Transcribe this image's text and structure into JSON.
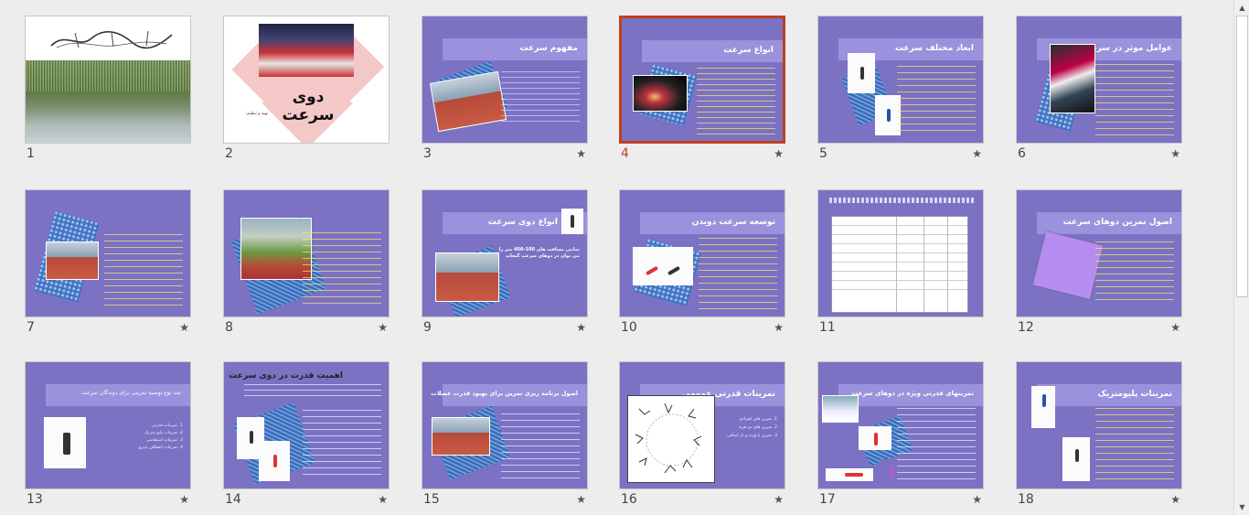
{
  "sorter": {
    "selected_index": 4,
    "slides": [
      {
        "number": "1",
        "title": "",
        "starred": false
      },
      {
        "number": "2",
        "title": "دوی سرعت",
        "starred": false
      },
      {
        "number": "3",
        "title": "مفهوم سرعت",
        "starred": true
      },
      {
        "number": "4",
        "title": "انواع سرعت",
        "starred": true
      },
      {
        "number": "5",
        "title": "ابعاد مختلف سرعت",
        "starred": true
      },
      {
        "number": "6",
        "title": "عوامل موثر در سرعت",
        "starred": true
      },
      {
        "number": "7",
        "title": "",
        "starred": true
      },
      {
        "number": "8",
        "title": "",
        "starred": true
      },
      {
        "number": "9",
        "title": "انواع دوی سرعت",
        "starred": true
      },
      {
        "number": "10",
        "title": "توسعه سرعت دویدن",
        "starred": true
      },
      {
        "number": "11",
        "title": "",
        "starred": false
      },
      {
        "number": "12",
        "title": "اصول تمرین دوهای سرعت",
        "starred": true
      },
      {
        "number": "13",
        "title": "چند نوع توصیه تمرینی برای دوندگان سرعت",
        "starred": true
      },
      {
        "number": "14",
        "title": "اهمیت قدرت در دوی سرعت",
        "starred": true
      },
      {
        "number": "15",
        "title": "اصول برنامه ریزی تمرین برای بهبود قدرت عضلات",
        "starred": true
      },
      {
        "number": "16",
        "title": "تمرینات قدرتی عمومی",
        "starred": true
      },
      {
        "number": "17",
        "title": "تمرینهای قدرتی ویژه در دوهای سرعت",
        "starred": true
      },
      {
        "number": "18",
        "title": "تمرینات پلیومتریک",
        "starred": true
      }
    ]
  },
  "content": {
    "s2_author": "تهیه و تنظیم:",
    "s9_body": "تمامی مسافت های 100-400 متر را می توان در دوهای سرعت گنجاند",
    "s13_items": [
      "1. تمرینات قدرتی",
      "2. تمرینات پلیو متریک",
      "3. تمرینات استقامتی",
      "4. تمرینات انعطاف پذیری"
    ],
    "s16_items": [
      "1. تمرین های انفرادی",
      "2. تمرین های دو نفره",
      "3. تمرین با وزنه و بار اضافی"
    ]
  },
  "icons": {
    "star": "★",
    "scroll_up": "▲",
    "scroll_down": "▼"
  },
  "colors": {
    "slide_bg": "#7b72c4",
    "selected_border": "#c43e1c",
    "accent_text": "#ffe66a"
  }
}
